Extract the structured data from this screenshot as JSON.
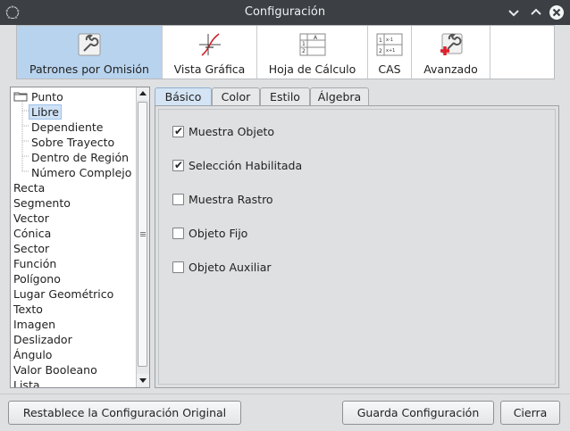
{
  "window": {
    "title": "Configuración"
  },
  "toolbar": {
    "items": [
      {
        "label": "Patrones por Omisión",
        "icon": "wrench-icon",
        "active": true
      },
      {
        "label": "Vista Gráfica",
        "icon": "graph-icon",
        "active": false
      },
      {
        "label": "Hoja de Cálculo",
        "icon": "spreadsheet-icon",
        "active": false
      },
      {
        "label": "CAS",
        "icon": "cas-icon",
        "active": false
      },
      {
        "label": "Avanzado",
        "icon": "advanced-wrench-icon",
        "active": false
      }
    ]
  },
  "tree": {
    "items": [
      {
        "label": "Punto",
        "level": 0,
        "folder": true
      },
      {
        "label": "Libre",
        "level": 1,
        "selected": true
      },
      {
        "label": "Dependiente",
        "level": 1
      },
      {
        "label": "Sobre Trayecto",
        "level": 1
      },
      {
        "label": "Dentro de Región",
        "level": 1
      },
      {
        "label": "Número Complejo",
        "level": 1
      },
      {
        "label": "Recta",
        "level": 0
      },
      {
        "label": "Segmento",
        "level": 0
      },
      {
        "label": "Vector",
        "level": 0
      },
      {
        "label": "Cónica",
        "level": 0
      },
      {
        "label": "Sector",
        "level": 0
      },
      {
        "label": "Función",
        "level": 0
      },
      {
        "label": "Polígono",
        "level": 0
      },
      {
        "label": "Lugar Geométrico",
        "level": 0
      },
      {
        "label": "Texto",
        "level": 0
      },
      {
        "label": "Imagen",
        "level": 0
      },
      {
        "label": "Deslizador",
        "level": 0
      },
      {
        "label": "Ángulo",
        "level": 0
      },
      {
        "label": "Valor Booleano",
        "level": 0
      },
      {
        "label": "Lista",
        "level": 0
      }
    ]
  },
  "tabs": [
    {
      "label": "Básico",
      "active": true
    },
    {
      "label": "Color",
      "active": false
    },
    {
      "label": "Estilo",
      "active": false
    },
    {
      "label": "Álgebra",
      "active": false
    }
  ],
  "options": [
    {
      "label": "Muestra Objeto",
      "checked": true
    },
    {
      "label": "Selección Habilitada",
      "checked": true
    },
    {
      "label": "Muestra Rastro",
      "checked": false
    },
    {
      "label": "Objeto Fijo",
      "checked": false
    },
    {
      "label": "Objeto Auxiliar",
      "checked": false
    }
  ],
  "footer": {
    "reset_label": "Restablece la Configuración Original",
    "save_label": "Guarda Configuración",
    "close_label": "Cierra"
  },
  "colors": {
    "titlebar": "#3c3f43",
    "active_tool": "#b8d3ee",
    "selection": "#cfe2f6"
  }
}
